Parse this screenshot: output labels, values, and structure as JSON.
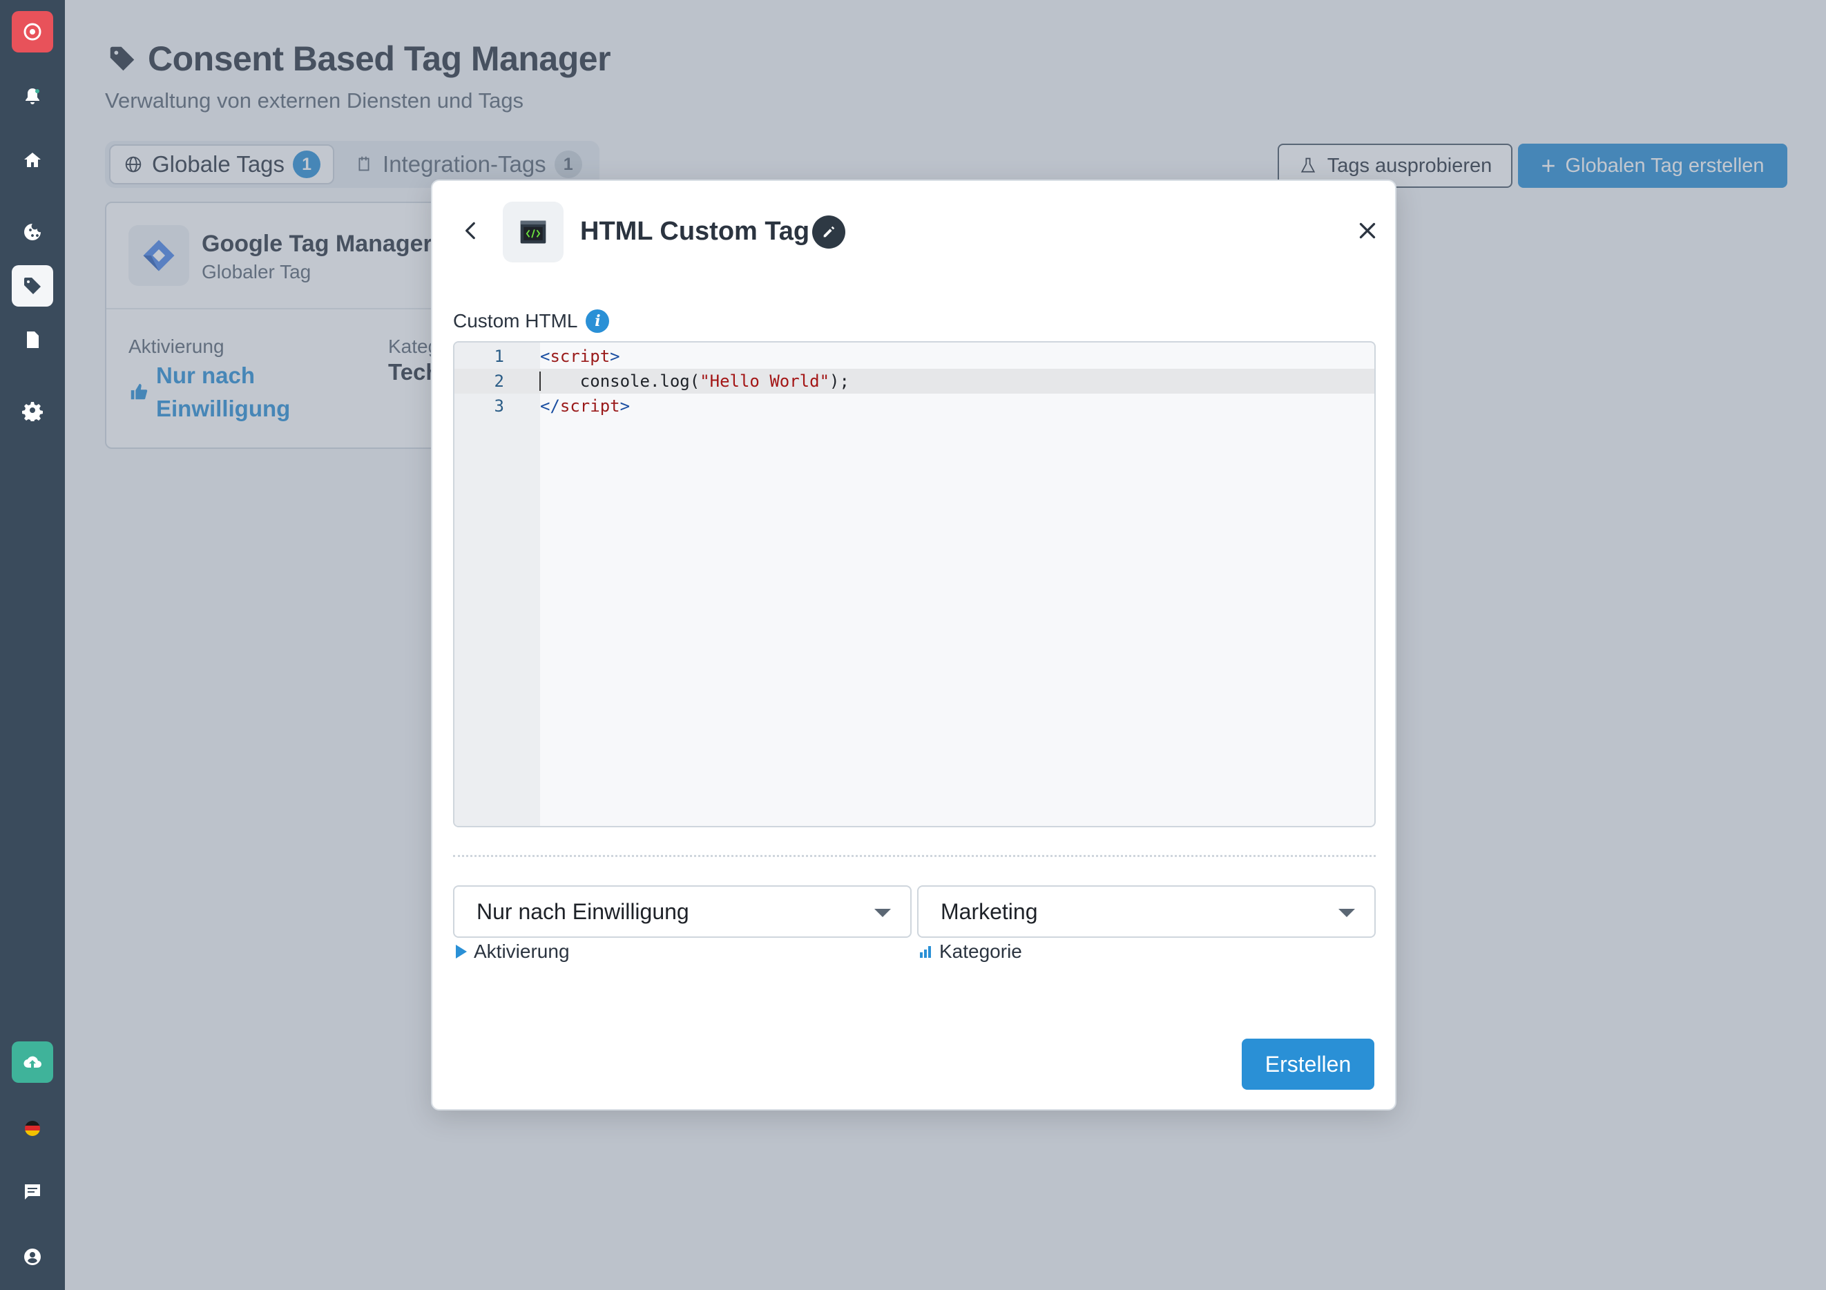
{
  "header": {
    "title": "Consent Based Tag Manager",
    "subtitle": "Verwaltung von externen Diensten und Tags"
  },
  "tabs": [
    {
      "label": "Globale Tags",
      "count": "1",
      "active": true
    },
    {
      "label": "Integration-Tags",
      "count": "1",
      "active": false
    }
  ],
  "actions": {
    "try_label": "Tags ausprobieren",
    "create_global_label": "Globalen Tag erstellen"
  },
  "card": {
    "title": "Google Tag Manager",
    "subtitle": "Globaler Tag",
    "activation_label": "Aktivierung",
    "activation_value_line1": "Nur nach",
    "activation_value_line2": "Einwilligung",
    "category_label": "Kateg",
    "category_value": "Tech"
  },
  "modal": {
    "title": "HTML Custom Tag",
    "field_label": "Custom HTML",
    "code_lines": [
      {
        "num": "1",
        "open": "<",
        "name": "script",
        "close": ">",
        "text": ""
      },
      {
        "num": "2",
        "text": "    console.log(\"Hello World\");"
      },
      {
        "num": "3",
        "open": "</",
        "name": "script",
        "close": ">",
        "text": ""
      }
    ],
    "activation_select_value": "Nur nach Einwilligung",
    "activation_select_label": "Aktivierung",
    "category_select_value": "Marketing",
    "category_select_label": "Kategorie",
    "create_label": "Erstellen"
  },
  "colors": {
    "accent": "#2a90d6",
    "sidebar": "#3a4b5c",
    "logo": "#e8525a",
    "upload": "#3fb39a"
  }
}
